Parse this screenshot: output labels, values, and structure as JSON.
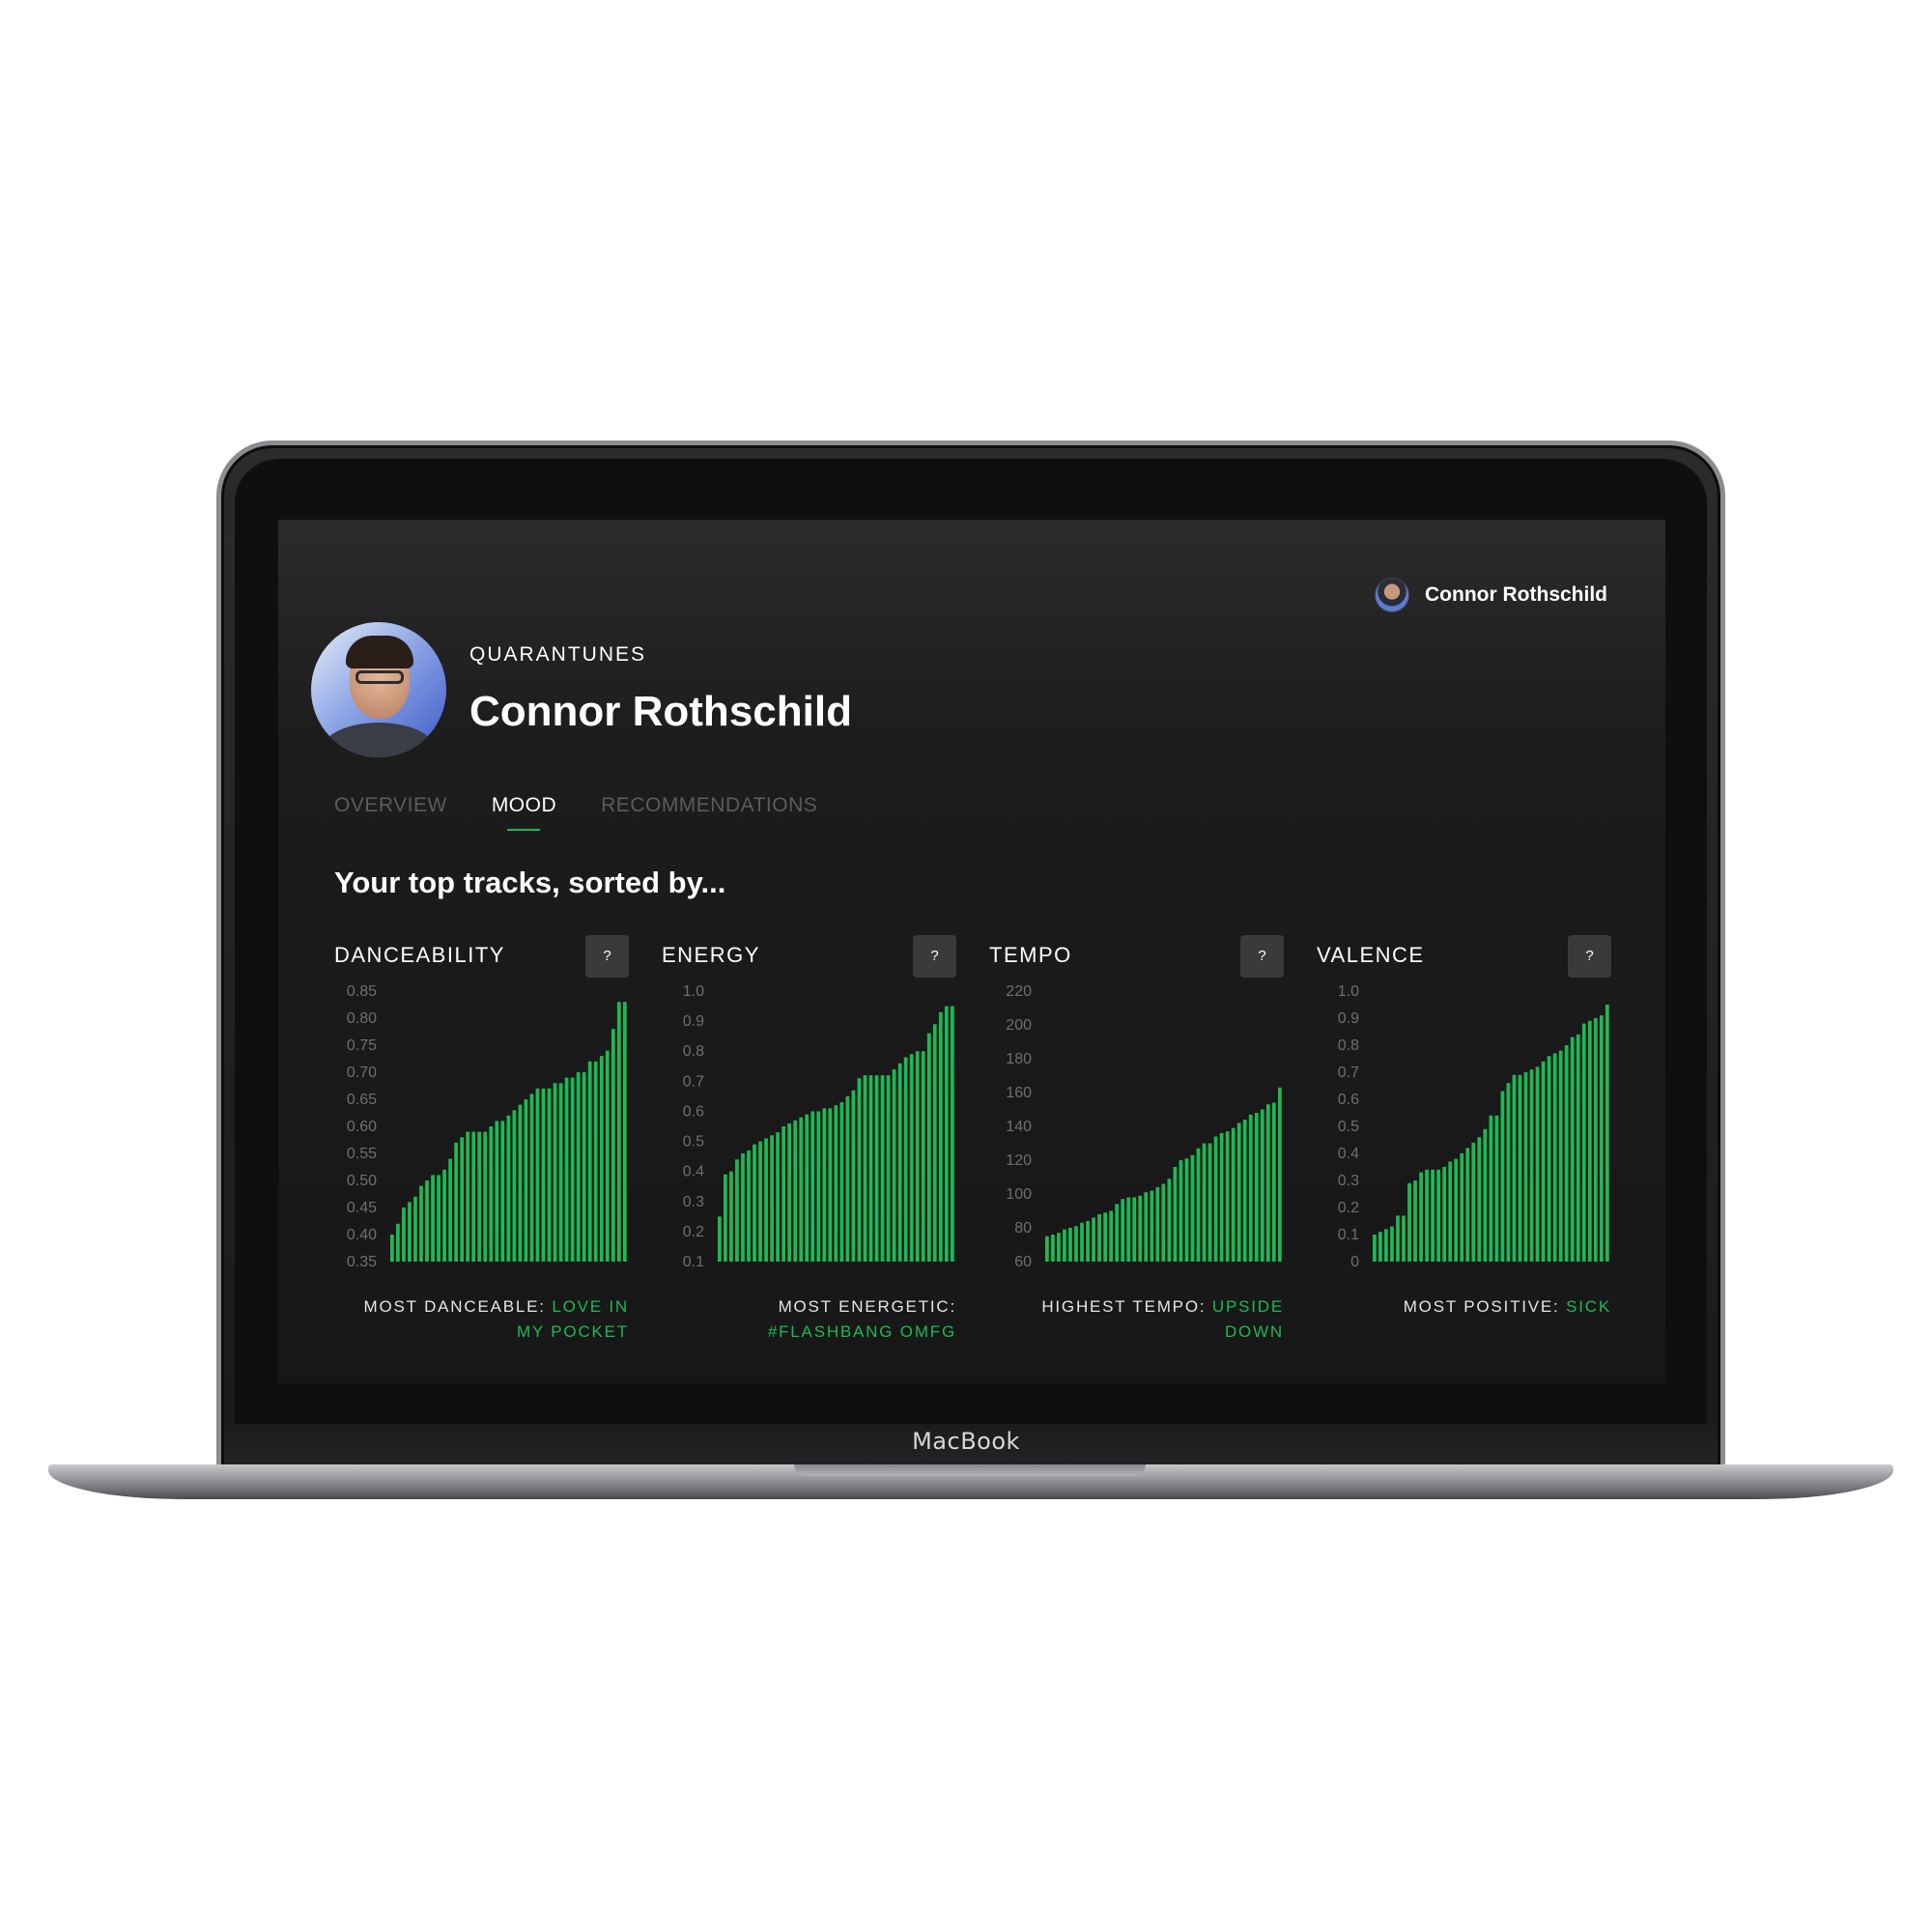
{
  "device": {
    "brand": "MacBook"
  },
  "header": {
    "user_name": "Connor Rothschild"
  },
  "profile": {
    "eyebrow": "QUARANTUNES",
    "name": "Connor Rothschild"
  },
  "tabs": [
    {
      "label": "OVERVIEW",
      "active": false
    },
    {
      "label": "MOOD",
      "active": true
    },
    {
      "label": "RECOMMENDATIONS",
      "active": false
    }
  ],
  "section_title": "Your top tracks, sorted by...",
  "help_label": "?",
  "accent_color": "#1db954",
  "chart_data": [
    {
      "type": "bar",
      "title": "DANCEABILITY",
      "ylim": [
        0.35,
        0.85
      ],
      "yticks": [
        "0.85",
        "0.80",
        "0.75",
        "0.70",
        "0.65",
        "0.60",
        "0.55",
        "0.50",
        "0.45",
        "0.40",
        "0.35"
      ],
      "values": [
        0.4,
        0.42,
        0.45,
        0.46,
        0.47,
        0.49,
        0.5,
        0.51,
        0.51,
        0.52,
        0.54,
        0.57,
        0.58,
        0.59,
        0.59,
        0.59,
        0.59,
        0.6,
        0.61,
        0.61,
        0.62,
        0.63,
        0.64,
        0.65,
        0.66,
        0.67,
        0.67,
        0.67,
        0.68,
        0.68,
        0.69,
        0.69,
        0.7,
        0.7,
        0.72,
        0.72,
        0.73,
        0.74,
        0.78,
        0.83,
        0.83
      ],
      "caption_label": "MOST DANCEABLE:",
      "caption_track": "LOVE IN MY POCKET"
    },
    {
      "type": "bar",
      "title": "ENERGY",
      "ylim": [
        0.1,
        1.0
      ],
      "yticks": [
        "1.0",
        "0.9",
        "0.8",
        "0.7",
        "0.6",
        "0.5",
        "0.4",
        "0.3",
        "0.2",
        "0.1"
      ],
      "values": [
        0.25,
        0.39,
        0.4,
        0.44,
        0.46,
        0.47,
        0.49,
        0.5,
        0.51,
        0.52,
        0.53,
        0.55,
        0.56,
        0.57,
        0.58,
        0.59,
        0.6,
        0.6,
        0.61,
        0.61,
        0.62,
        0.63,
        0.65,
        0.67,
        0.71,
        0.72,
        0.72,
        0.72,
        0.72,
        0.72,
        0.74,
        0.76,
        0.78,
        0.79,
        0.8,
        0.8,
        0.86,
        0.89,
        0.93,
        0.95,
        0.95
      ],
      "caption_label": "MOST ENERGETIC:",
      "caption_track": "#FLASHBANG OMFG"
    },
    {
      "type": "bar",
      "title": "TEMPO",
      "ylim": [
        60,
        220
      ],
      "yticks": [
        "220",
        "200",
        "180",
        "160",
        "140",
        "120",
        "100",
        "80",
        "60"
      ],
      "values": [
        75,
        76,
        77,
        79,
        80,
        81,
        83,
        84,
        86,
        88,
        89,
        90,
        94,
        97,
        98,
        98,
        99,
        101,
        102,
        104,
        106,
        109,
        116,
        120,
        121,
        123,
        127,
        130,
        130,
        134,
        136,
        137,
        139,
        142,
        144,
        147,
        148,
        150,
        153,
        154,
        163
      ],
      "caption_label": "HIGHEST TEMPO:",
      "caption_track": "UPSIDE DOWN"
    },
    {
      "type": "bar",
      "title": "VALENCE",
      "ylim": [
        0,
        1.0
      ],
      "yticks": [
        "1.0",
        "0.9",
        "0.8",
        "0.7",
        "0.6",
        "0.5",
        "0.4",
        "0.3",
        "0.2",
        "0.1",
        "0"
      ],
      "values": [
        0.1,
        0.11,
        0.12,
        0.13,
        0.17,
        0.17,
        0.29,
        0.3,
        0.33,
        0.34,
        0.34,
        0.34,
        0.35,
        0.37,
        0.38,
        0.4,
        0.42,
        0.44,
        0.46,
        0.49,
        0.54,
        0.54,
        0.63,
        0.66,
        0.69,
        0.69,
        0.7,
        0.71,
        0.72,
        0.74,
        0.76,
        0.77,
        0.78,
        0.8,
        0.83,
        0.84,
        0.88,
        0.89,
        0.9,
        0.91,
        0.95
      ],
      "caption_label": "MOST POSITIVE:",
      "caption_track": "SICK"
    }
  ]
}
